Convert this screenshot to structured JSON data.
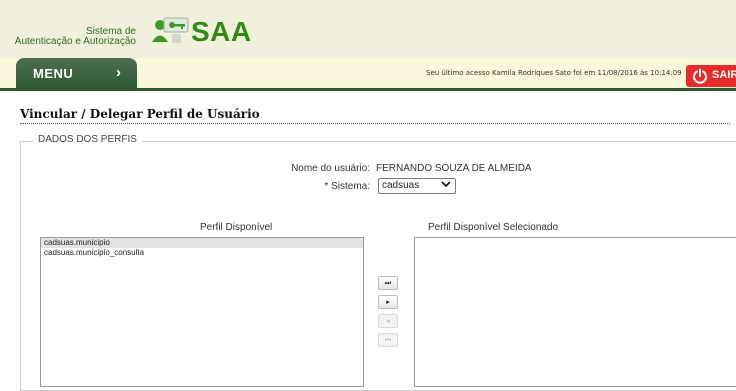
{
  "app": {
    "brand_line1": "Sistema de",
    "brand_line2": "Autenticação e Autorização",
    "logo_name": "SAA",
    "logo_icon": "users-key-icon"
  },
  "nav": {
    "menu_label": "MENU",
    "menu_chevron": "›",
    "last_access": "Seu último acesso Kamila Rodriques Sato foi em 11/08/2016 às 10:14:09",
    "logout_label": "SAIR",
    "logout_icon": "power-icon"
  },
  "page": {
    "title": "Vincular / Delegar Perfil de Usuário"
  },
  "form": {
    "section_legend": "DADOS DOS PERFIS",
    "user_label": "Nome do usuário:",
    "user_value": "FERNANDO SOUZA DE ALMEIDA",
    "system_label": "* Sistema:",
    "system_value": "cadsuas",
    "available_header": "Perfil Disponível",
    "selected_header": "Perfil Disponível Selecionado",
    "available_items": [
      "cadsuas.municipio",
      "cadsuas.municipio_consulta"
    ],
    "selected_items": [],
    "move_buttons": {
      "all_right": "⏭",
      "right": "▸",
      "left": "◂",
      "all_left": "⏮"
    }
  },
  "colors": {
    "brand_green": "#2f8a12",
    "menu_green": "#2c5a31",
    "logout_red": "#e82a2a"
  }
}
